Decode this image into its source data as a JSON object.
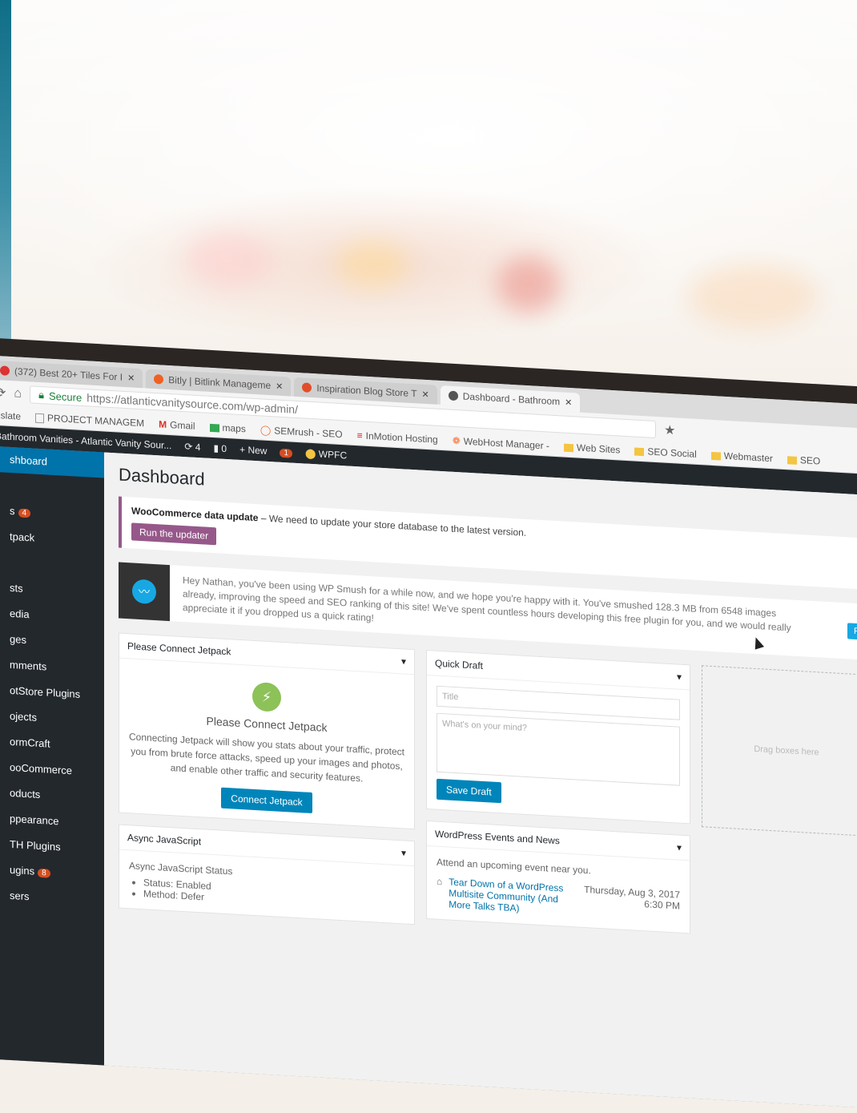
{
  "browser": {
    "tabs": [
      {
        "label": "(372) Best 20+ Tiles For I",
        "icon_color": "#d33"
      },
      {
        "label": "Bitly | Bitlink Manageme",
        "icon_color": "#ee6123"
      },
      {
        "label": "Inspiration Blog Store T",
        "icon_color": "#e14d2a"
      },
      {
        "label": "Dashboard - Bathroom",
        "icon_color": "#555"
      }
    ],
    "secure_label": "Secure",
    "url": "https://atlanticvanitysource.com/wp-admin/",
    "bookmarks": [
      {
        "label": "nslate",
        "icon": "translate-icon",
        "color": "#4285f4"
      },
      {
        "label": "PROJECT MANAGEM",
        "icon": "page-icon",
        "color": "#999999"
      },
      {
        "label": "Gmail",
        "icon": "gmail-icon",
        "color": "#d93025"
      },
      {
        "label": "maps",
        "icon": "maps-icon",
        "color": "#34a853"
      },
      {
        "label": "SEMrush - SEO",
        "icon": "semrush-icon",
        "color": "#ff642d"
      },
      {
        "label": "InMotion Hosting",
        "icon": "inmotion-icon",
        "color": "#e11"
      },
      {
        "label": "WebHost Manager -",
        "icon": "whm-icon",
        "color": "#ff6c2c"
      },
      {
        "label": "Web Sites",
        "icon": "folder-icon",
        "color": "#f4c542"
      },
      {
        "label": "SEO Social",
        "icon": "folder-icon",
        "color": "#f4c542"
      },
      {
        "label": "Webmaster",
        "icon": "folder-icon",
        "color": "#f4c542"
      },
      {
        "label": "SEO",
        "icon": "folder-icon",
        "color": "#f4c542"
      }
    ]
  },
  "adminbar": {
    "site": "Bathroom Vanities - Atlantic Vanity Sour...",
    "updates": "4",
    "comments": "0",
    "new": "New",
    "notify_count": "1",
    "wpfc": "WPFC"
  },
  "sidebar": {
    "items": [
      {
        "label": "shboard",
        "active": true
      },
      {
        "label": ""
      },
      {
        "label": "s",
        "badge": "4"
      },
      {
        "label": "tpack"
      },
      {
        "label": ""
      },
      {
        "label": "sts"
      },
      {
        "label": "edia"
      },
      {
        "label": "ges"
      },
      {
        "label": "mments"
      },
      {
        "label": "otStore Plugins"
      },
      {
        "label": "ojects"
      },
      {
        "label": "ormCraft"
      },
      {
        "label": "ooCommerce"
      },
      {
        "label": "oducts"
      },
      {
        "label": "ppearance"
      },
      {
        "label": "TH Plugins"
      },
      {
        "label": "ugins",
        "badge": "8"
      },
      {
        "label": "sers"
      }
    ]
  },
  "dashboard": {
    "title": "Dashboard",
    "woo_notice": {
      "strong": "WooCommerce data update",
      "text": " – We need to update your store database to the latest version.",
      "button": "Run the updater"
    },
    "smush": {
      "text": "Hey Nathan, you've been using WP Smush for a while now, and we hope you're happy with it. You've smushed 128.3 MB from 6548 images already, improving the speed and SEO ranking of this site! We've spent countless hours developing this free plugin for you, and we would really appreciate it if you dropped us a quick rating!",
      "button": "Rate WP"
    },
    "jetpack": {
      "header": "Please Connect Jetpack",
      "title": "Please Connect Jetpack",
      "text": "Connecting Jetpack will show you stats about your traffic, protect you from brute force attacks, speed up your images and photos, and enable other traffic and security features.",
      "button": "Connect Jetpack"
    },
    "quick_draft": {
      "header": "Quick Draft",
      "title_placeholder": "Title",
      "body_placeholder": "What's on your mind?",
      "button": "Save Draft"
    },
    "async": {
      "header": "Async JavaScript",
      "subtitle": "Async JavaScript Status",
      "status": "Status: Enabled",
      "method": "Method: Defer"
    },
    "events": {
      "header": "WordPress Events and News",
      "intro": "Attend an upcoming event near you.",
      "event_title": "Tear Down of a WordPress Multisite Community (And More Talks TBA)",
      "event_date": "Thursday, Aug 3, 2017",
      "event_time": "6:30 PM"
    },
    "dropzone_label": "Drag boxes here"
  },
  "colors": {
    "wp_sidebar": "#23282d",
    "wp_blue": "#0073aa",
    "woo_purple": "#96588a",
    "jetpack_green": "#8cc258",
    "smush_blue": "#17a8e3"
  }
}
